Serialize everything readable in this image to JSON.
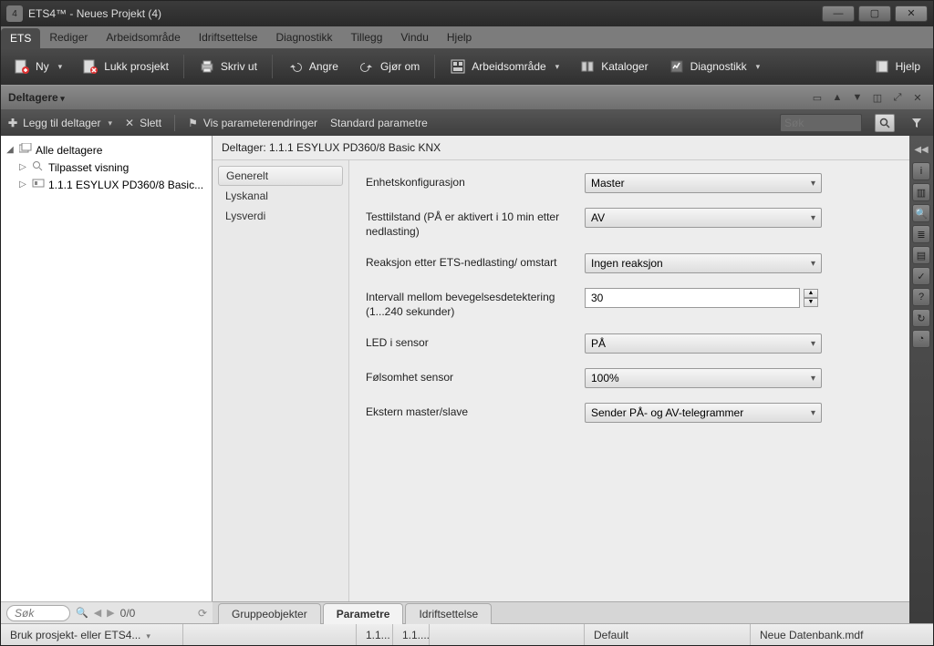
{
  "titlebar": {
    "app": "ETS4™",
    "project": "Neues Projekt (4)"
  },
  "menu": {
    "items": [
      "ETS",
      "Rediger",
      "Arbeidsområde",
      "Idriftsettelse",
      "Diagnostikk",
      "Tillegg",
      "Vindu",
      "Hjelp"
    ],
    "active_index": 0
  },
  "toolbar": {
    "new": "Ny",
    "close": "Lukk prosjekt",
    "print": "Skriv ut",
    "undo": "Angre",
    "redo": "Gjør om",
    "workspace": "Arbeidsområde",
    "catalogs": "Kataloger",
    "diagnostics": "Diagnostikk",
    "help": "Hjelp"
  },
  "panel": {
    "title": "Deltagere"
  },
  "subtool": {
    "add": "Legg til deltager",
    "delete": "Slett",
    "showchanges": "Vis parameterendringer",
    "defaults": "Standard parametre",
    "search_ph": "Søk"
  },
  "tree": {
    "root": "Alle deltagere",
    "items": [
      {
        "label": "Tilpasset visning"
      },
      {
        "label": "1.1.1  ESYLUX PD360/8 Basic..."
      }
    ]
  },
  "right": {
    "header": "Deltager: 1.1.1  ESYLUX PD360/8 Basic KNX",
    "sections": [
      "Generelt",
      "Lyskanal",
      "Lysverdi"
    ],
    "section_sel": 0,
    "params": [
      {
        "label": "Enhetskonfigurasjon",
        "value": "Master",
        "type": "combo"
      },
      {
        "label": "Testtilstand (PÅ er aktivert i 10 min etter nedlasting)",
        "value": "AV",
        "type": "combo"
      },
      {
        "label": "Reaksjon etter ETS-nedlasting/ omstart",
        "value": "Ingen reaksjon",
        "type": "combo"
      },
      {
        "label": "Intervall mellom bevegelsesdetektering (1...240 sekunder)",
        "value": "30",
        "type": "spin"
      },
      {
        "label": "LED i sensor",
        "value": "PÅ",
        "type": "combo"
      },
      {
        "label": "Følsomhet sensor",
        "value": "100%",
        "type": "combo"
      },
      {
        "label": "Ekstern master/slave",
        "value": "Sender PÅ- og AV-telegrammer",
        "type": "combo"
      }
    ],
    "tabs": [
      "Gruppeobjekter",
      "Parametre",
      "Idriftsettelse"
    ],
    "tab_sel": 1
  },
  "treefoot": {
    "search_ph": "Søk",
    "counter": "0/0"
  },
  "status": {
    "c1": "Bruk prosjekt- eller ETS4...",
    "c3": "1.1...",
    "c4": "1.1....",
    "c6": "Default",
    "c7": "Neue Datenbank.mdf"
  }
}
